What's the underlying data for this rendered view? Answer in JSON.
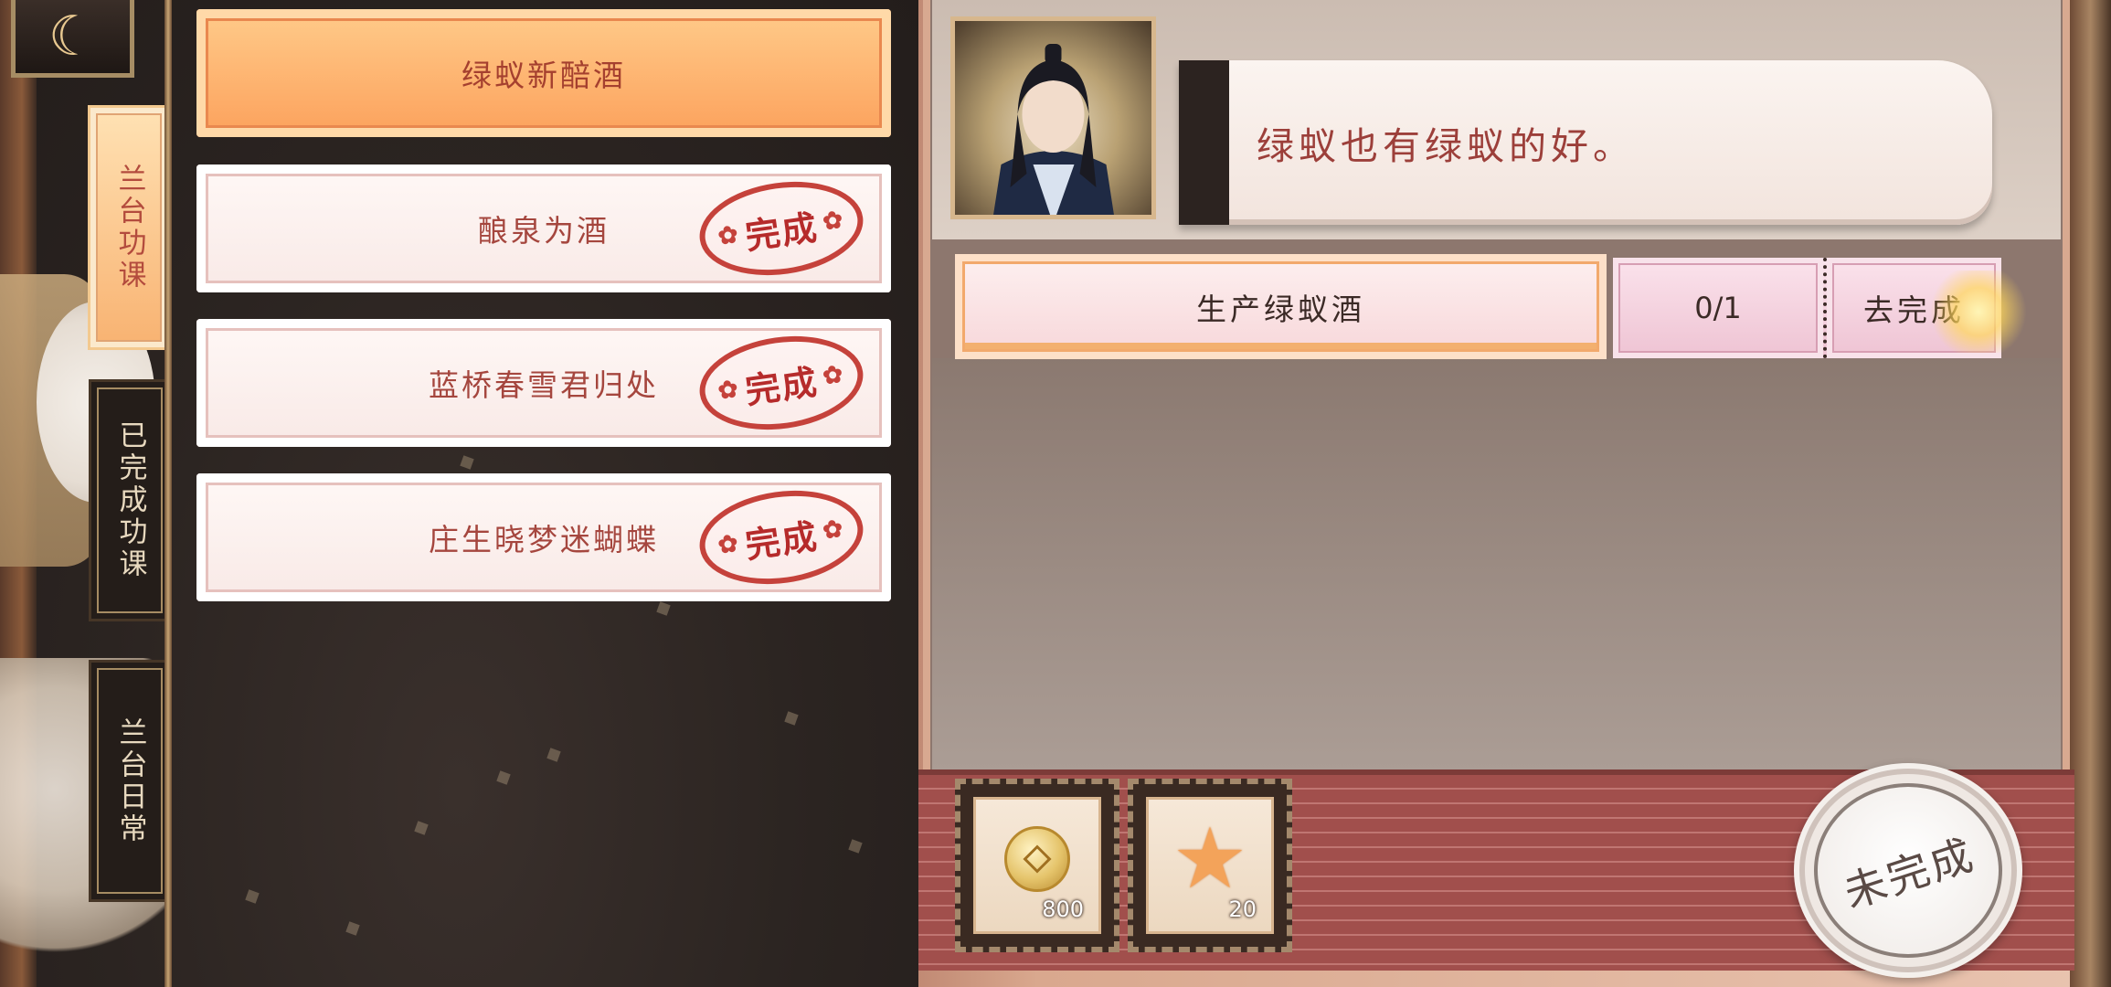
{
  "side_tabs": [
    {
      "label": "兰台功课",
      "state": "active"
    },
    {
      "label": "已完成功课",
      "state": "inactive"
    },
    {
      "label": "兰台日常",
      "state": "inactive"
    }
  ],
  "quests": [
    {
      "title": "绿蚁新醅酒",
      "state": "selected",
      "stamp": ""
    },
    {
      "title": "酿泉为酒",
      "state": "completed",
      "stamp": "完成"
    },
    {
      "title": "蓝桥春雪君归处",
      "state": "completed",
      "stamp": "完成"
    },
    {
      "title": "庄生晓梦迷蝴蝶",
      "state": "completed",
      "stamp": "完成"
    }
  ],
  "dialogue": {
    "text": "绿蚁也有绿蚁的好。"
  },
  "task": {
    "name": "生产绿蚁酒",
    "progress": "0/1",
    "action": "去完成"
  },
  "rewards": [
    {
      "icon": "coin-icon",
      "count": "800"
    },
    {
      "icon": "star-icon",
      "count": "20"
    }
  ],
  "status_button": "未完成",
  "colors": {
    "accent_orange": "#fca15c",
    "stamp_red": "#c5423b",
    "text_red": "#9c3f3a",
    "panel_brown": "#8d776e"
  }
}
